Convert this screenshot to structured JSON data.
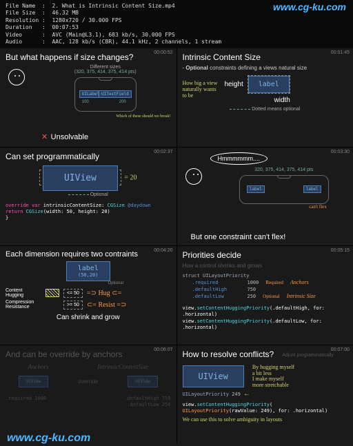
{
  "header": {
    "file_name_label": "File Name  :",
    "file_name": "2. What is Intrinsic Content Size.mp4",
    "file_size_label": "File Size  :",
    "file_size": "46.32 MB",
    "resolution_label": "Resolution :",
    "resolution": "1280x720 / 30.000 FPS",
    "duration_label": "Duration   :",
    "duration": "00:07:53",
    "video_label": "Video      :",
    "video": "AVC (Main@L3.1), 683 kb/s, 30.000 FPS",
    "audio_label": "Audio      :",
    "audio": "AAC, 128 kb/s (CBR), 44.1 kHz, 2 channels, 1 stream"
  },
  "watermark_top": "www.cg-ku.com",
  "watermark_bottom": "www.cg-ku.com",
  "panels": [
    {
      "timestamp": "00:00:52",
      "title": "But what happens if size changes?",
      "diff_sizes": "Different sizes",
      "sizes_list": "(320, 375, 414, 375, 414 pts)",
      "box1": "UILabel",
      "box2": "UITextField",
      "num1": "100",
      "num2": "200",
      "unsolvable_x": "✕",
      "unsolvable": "Unsolvable",
      "which": "Which of these should we break!"
    },
    {
      "timestamp": "00:01:45",
      "title": "Intrinsic Content Size",
      "subtitle_prefix": "- ",
      "subtitle_bold": "Optional",
      "subtitle_rest": " constraints defining a views natural size",
      "hand1": "How big a view",
      "hand2": "naturally wants",
      "hand3": "to be",
      "height": "height",
      "width": "width",
      "label": "label",
      "dotted_note": "Dotted means optional"
    },
    {
      "timestamp": "00:02:37",
      "title": "Can set programmatically",
      "uiview": "UIView",
      "eq20": " = 20",
      "optional": "Optional",
      "code_override": "override ",
      "code_var": "var ",
      "code_ics": "intrinsicContentSize: ",
      "code_cgsize": "CGSize",
      "code_daydown": " @daydown ",
      "code_return": "    return ",
      "code_cgsize2": "CGSize",
      "code_args": "(width: 50, height: 20)",
      "code_brace": "}"
    },
    {
      "timestamp": "00:03:30",
      "hmm": "Hmmmmmm....",
      "sizes": "320, 375, 414, 375, 414 pts",
      "box1": "label",
      "box2": "label",
      "cant_flex": "can't flex",
      "footer": "But one constraint can't flex!"
    },
    {
      "timestamp": "00:04:20",
      "title": "Each dimension requires two contraints",
      "label": "label",
      "label_dim": "(50,20)",
      "optional": "Optional",
      "ch": "Content Hugging",
      "cr": "Compression Resistance",
      "le50": "<= 50",
      "ge50": ">= 50",
      "hug": "Hug",
      "resist": "Resist",
      "footer": "Can shrink and grow"
    },
    {
      "timestamp": "00:05:15",
      "title": "Priorities decide",
      "subtitle": "How a control shrinks and grows",
      "struct_kw": "struct ",
      "struct_name": "UILayoutPriority",
      "req": ".required",
      "req_v": "1000",
      "req_lbl": "Required",
      "dh": ".defaultHigh",
      "dh_v": "750",
      "anchors": "Anchors",
      "dl": ".defaultLow",
      "dl_v": "250",
      "opt": "Optional",
      "ics": "Intrinsic Size",
      "code1a": "view.",
      "code1b": "setContentHuggingPriority",
      "code1c": "(.defaultHigh, for: .horizontal)",
      "code2a": "view.",
      "code2b": "setContentHuggingPriority",
      "code2c": "(.defaultLow, for: .horizontal)"
    },
    {
      "timestamp": "00:06:07",
      "title": "And can be override by anchors",
      "anchors": "Anchors",
      "ics": "IntrinsicContentSize",
      "uiview": "UIView",
      "override": "override",
      "req": ".required",
      "req_v": "1000",
      "dh": ".defaultHigh",
      "dh_v": "750",
      "dl": ".defaultLow",
      "dl_v": "250"
    },
    {
      "timestamp": "00:07:00",
      "title": "How to resolve conflicts?",
      "adjust": "Adjust programmatically",
      "uiview": "UIView",
      "hand1": "By hugging myself",
      "hand2": "a bit less",
      "hand3": "I make myself",
      "hand4": "more stretchable",
      "pri_label": "UILayoutPriority ",
      "pri_val": "249",
      "arrow": "←",
      "code1a": "view.",
      "code1b": "setContentHuggingPriority",
      "code1c": "(",
      "code2a": "    UILayoutPriority",
      "code2b": "(rawValue: 249), for: .horizontal)",
      "footer": "We can use this to solve ambiguity in layouts"
    }
  ]
}
